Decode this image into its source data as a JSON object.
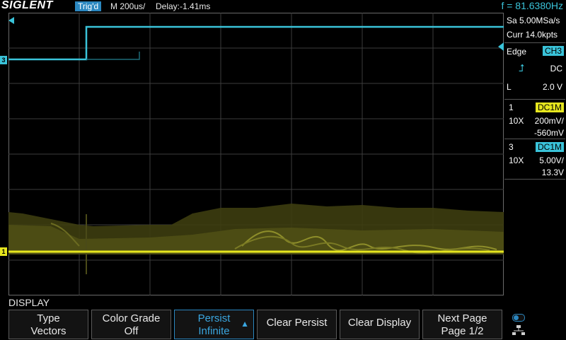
{
  "header": {
    "brand": "SIGLENT",
    "trigger_status": "Trig'd",
    "timebase": "M 200us/",
    "delay": "Delay:-1.41ms",
    "frequency": "f = 81.6380Hz"
  },
  "acquisition": {
    "sample_rate": "Sa 5.00MSa/s",
    "memory_depth": "Curr 14.0kpts"
  },
  "trigger": {
    "type": "Edge",
    "source": "CH3",
    "coupling": "DC",
    "slope_label": "L",
    "level": "2.0 V"
  },
  "channels": [
    {
      "number": "1",
      "coupling": "DC1M",
      "probe": "10X",
      "scale": "200mV/",
      "offset": "-560mV",
      "color": "#e6e61e"
    },
    {
      "number": "3",
      "coupling": "DC1M",
      "probe": "10X",
      "scale": "5.00V/",
      "offset": "13.3V",
      "color": "#3ac3d9"
    }
  ],
  "markers": {
    "ch3": "3",
    "ch1": "1"
  },
  "menu": {
    "title": "DISPLAY",
    "buttons": [
      {
        "line1": "Type",
        "line2": "Vectors"
      },
      {
        "line1": "Color Grade",
        "line2": "Off"
      },
      {
        "line1": "Persist",
        "line2": "Infinite"
      },
      {
        "line1": "Clear Persist"
      },
      {
        "line1": "Clear Display"
      },
      {
        "line1": "Next Page",
        "line2": "Page 1/2"
      }
    ]
  },
  "colors": {
    "accent": "#2b87c0",
    "ch1": "#e6e61e",
    "ch3": "#3ac3d9",
    "grid": "#5a5a5a"
  }
}
